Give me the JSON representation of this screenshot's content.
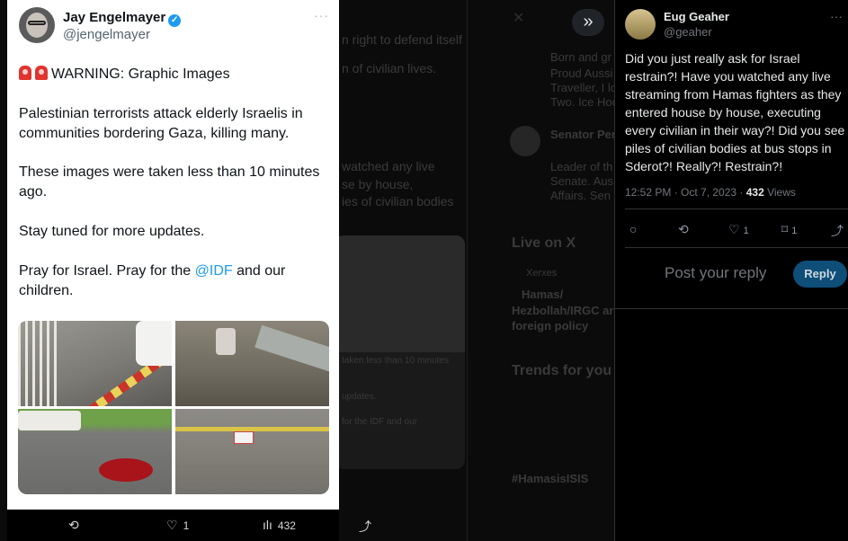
{
  "backdrop": {
    "lines": [
      "n right to defend itself",
      "n of civilian lives.",
      "watched any live",
      "se by house,",
      "ies of civilian bodies",
      "taken less than 10 minutes",
      "updates.",
      "for the IDF and our"
    ],
    "side_lines": [
      "Born and gr",
      "Proud Aussi",
      "Traveller, I lo",
      "Two. Ice Hoc",
      "Senator Per",
      "Leader of th",
      "Senate. Aus",
      "Affairs. Sen",
      "Live on X",
      "Xerxes",
      "Hamas/",
      "Hezbollah/IRGC ar",
      "foreign policy",
      "Trends for you",
      "#HamasisISIS"
    ]
  },
  "card": {
    "author_name": "Jay Engelmayer",
    "author_handle": "@jengelmayer",
    "more": "···",
    "warning": "WARNING: Graphic Images",
    "para1": "Palestinian terrorists attack elderly Israelis in communities bordering Gaza, killing many.",
    "para2": "These images were taken less than 10 minutes ago.",
    "para3": "Stay tuned for more updates.",
    "para4_pre": "Pray for Israel. Pray for the ",
    "para4_mention": "@IDF",
    "para4_post": " and our children.",
    "actions": {
      "retweet_icon": "⟲",
      "like_icon": "♡",
      "like_count": "1",
      "views_icon": "ılı",
      "views_count": "432",
      "share_icon": "⤴"
    }
  },
  "panel": {
    "collapse_icon": "»",
    "author_name": "Eug Geaher",
    "author_handle": "@geaher",
    "more": "···",
    "text": "Did you just really ask for Israel restrain?! Have you watched any live streaming from Hamas fighters as they entered house by house, executing every civilian in their way?! Did you see piles of civilian bodies at bus stops in Sderot?! Really?! Restrain?!",
    "time": "12:52 PM · Oct 7, 2023 · ",
    "views_count": "432",
    "views_label": " Views",
    "actions": {
      "reply_icon": "○",
      "retweet_icon": "⟲",
      "like_icon": "♡",
      "like_count": "1",
      "bookmark_icon": "⌑",
      "bookmark_count": "1",
      "share_icon": "⤴"
    },
    "reply_placeholder": "Post your reply",
    "reply_button": "Reply"
  }
}
